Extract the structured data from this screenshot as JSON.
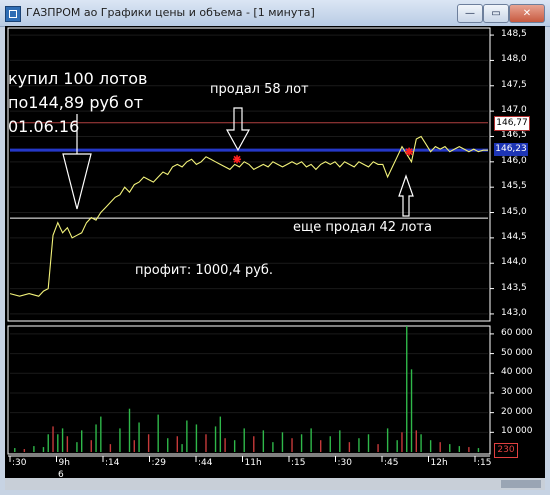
{
  "window": {
    "title": "ГАЗПРОМ ао Графики цены и объема - [1 минута]",
    "minimize_glyph": "—",
    "maximize_glyph": "▭",
    "close_glyph": "✕",
    "icon": "chart-window-icon"
  },
  "annotations": {
    "buy": [
      "купил 100 лотов",
      "по144,89 руб от",
      "01.06.16"
    ],
    "sold1": "продал 58 лот",
    "sold2": "еще продал  42 лота",
    "profit": "профит:  1000,4 руб."
  },
  "price_axis": {
    "ticks": [
      "148,5",
      "148,0",
      "147,5",
      "147,0",
      "146,5",
      "146,0",
      "145,5",
      "145,0",
      "144,5",
      "144,0",
      "143,5",
      "143,0"
    ],
    "min": 142.9,
    "max": 148.6,
    "level_high_badge": "146,77",
    "level_current_badge": "146,23"
  },
  "volume_axis": {
    "ticks": [
      "60 000",
      "50 000",
      "40 000",
      "30 000",
      "20 000",
      "10 000"
    ],
    "max": 63000,
    "last_badge": "230"
  },
  "time_axis": {
    "ticks": [
      ":30",
      "9h",
      ":14",
      ":29",
      ":44",
      "11h",
      ":15",
      ":30",
      ":45",
      "12h",
      ":15"
    ],
    "sub_label": "6"
  },
  "colors": {
    "price_line": "#f2f27a",
    "up_volume": "#2fb84a",
    "down_volume": "#c63a3a",
    "resistance_line": "#b04040",
    "current_line": "#2538c8",
    "entry_line": "#ffffff",
    "trade_marker": "#ff2020",
    "grid": "#1a1a1a"
  },
  "chart_data": {
    "type": "line",
    "x_domain": [
      0,
      100
    ],
    "series": [
      {
        "x": [
          0,
          2,
          4,
          6,
          7,
          8,
          9,
          10,
          11,
          12,
          13,
          14,
          15,
          16,
          17,
          18,
          19,
          20,
          21,
          22,
          23,
          24,
          25,
          26,
          27,
          28,
          29,
          30,
          31,
          32,
          33,
          34,
          35,
          36,
          37,
          38,
          39,
          40,
          41,
          42,
          43,
          44,
          45,
          46,
          47,
          48,
          49,
          50,
          51,
          52,
          53,
          54,
          55,
          56,
          57,
          58,
          59,
          60,
          61,
          62,
          63,
          64,
          65,
          66,
          67,
          68,
          69,
          70,
          71,
          72,
          73,
          74,
          75,
          76,
          77,
          78,
          79,
          80,
          81,
          82,
          83,
          84,
          85,
          86,
          87,
          88,
          89,
          90,
          91,
          92,
          93,
          94,
          95,
          96,
          97,
          98,
          99,
          100
        ],
        "y": [
          143.4,
          143.35,
          143.4,
          143.35,
          143.45,
          143.5,
          144.55,
          144.8,
          144.6,
          144.7,
          144.5,
          144.55,
          144.6,
          144.8,
          144.9,
          144.85,
          145.0,
          145.1,
          145.2,
          145.3,
          145.35,
          145.5,
          145.4,
          145.55,
          145.6,
          145.7,
          145.65,
          145.6,
          145.7,
          145.8,
          145.75,
          145.9,
          145.95,
          145.9,
          146.0,
          146.05,
          145.95,
          146.0,
          146.1,
          146.05,
          146.0,
          145.95,
          145.9,
          145.85,
          145.95,
          145.9,
          146.0,
          145.95,
          145.85,
          145.9,
          145.95,
          145.9,
          146.0,
          145.95,
          145.9,
          145.95,
          146.0,
          145.95,
          146.0,
          145.9,
          145.95,
          145.85,
          145.95,
          146.0,
          145.95,
          146.0,
          145.9,
          146.0,
          145.95,
          145.9,
          146.0,
          145.95,
          145.9,
          146.0,
          145.95,
          145.95,
          145.7,
          145.9,
          146.1,
          146.3,
          146.15,
          146.0,
          146.45,
          146.5,
          146.35,
          146.2,
          146.3,
          146.25,
          146.3,
          146.2,
          146.25,
          146.3,
          146.25,
          146.2,
          146.25,
          146.2,
          146.23,
          146.23
        ]
      }
    ],
    "reference_lines": [
      146.77,
      146.23,
      144.89
    ],
    "trade_markers": [
      {
        "x": 47.5,
        "y": 146.05,
        "label": "sell"
      },
      {
        "x": 83.5,
        "y": 146.2,
        "label": "sell"
      }
    ],
    "volume": {
      "x": [
        1,
        3,
        5,
        7,
        8,
        9,
        10,
        11,
        12,
        14,
        15,
        17,
        18,
        19,
        21,
        23,
        25,
        26,
        27,
        29,
        31,
        33,
        35,
        36,
        37,
        39,
        41,
        43,
        44,
        45,
        47,
        49,
        51,
        53,
        55,
        57,
        59,
        61,
        63,
        65,
        67,
        69,
        71,
        73,
        75,
        77,
        79,
        81,
        82,
        83,
        84,
        85,
        86,
        88,
        90,
        92,
        94,
        96,
        98
      ],
      "values": [
        2000,
        1500,
        3000,
        2500,
        9000,
        13000,
        9000,
        12000,
        8000,
        5000,
        11000,
        6000,
        14000,
        18000,
        4000,
        12000,
        22000,
        6000,
        15000,
        9000,
        19000,
        7000,
        8000,
        4000,
        16000,
        14000,
        9000,
        13000,
        18000,
        7000,
        6000,
        12000,
        8000,
        11000,
        5000,
        10000,
        7000,
        9000,
        12000,
        6000,
        8000,
        11000,
        5000,
        7000,
        9000,
        4000,
        12000,
        6000,
        10000,
        64000,
        42000,
        11000,
        9000,
        6000,
        5000,
        4000,
        3000,
        2500,
        2000
      ],
      "up": [
        true,
        false,
        true,
        true,
        true,
        false,
        true,
        true,
        false,
        true,
        true,
        false,
        true,
        true,
        false,
        true,
        true,
        false,
        true,
        false,
        true,
        true,
        false,
        true,
        true,
        true,
        false,
        true,
        true,
        false,
        true,
        true,
        false,
        true,
        true,
        true,
        false,
        true,
        true,
        false,
        true,
        true,
        false,
        true,
        true,
        false,
        true,
        true,
        false,
        true,
        true,
        false,
        true,
        true,
        false,
        true,
        true,
        false,
        true
      ]
    }
  }
}
